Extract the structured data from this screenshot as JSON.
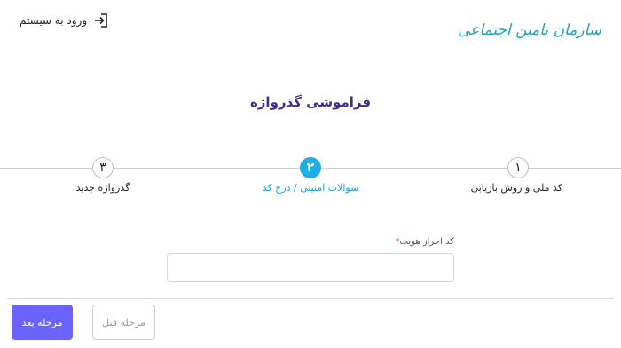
{
  "header": {
    "logo_text": "سازمان تامین اجتماعی",
    "login_label": "ورود به سیستم",
    "icons": {
      "logo": "social-security-emblem",
      "login": "sign-in-arrow-icon"
    }
  },
  "page": {
    "title": "فراموشی گذرواژه"
  },
  "stepper": {
    "steps": [
      {
        "number": "۱",
        "label": "کد ملی و روش بازیابی",
        "state": "done"
      },
      {
        "number": "۲",
        "label": "سوالات امنیتی / درج کد",
        "state": "active"
      },
      {
        "number": "۳",
        "label": "گذرواژه جدید",
        "state": "pending"
      }
    ]
  },
  "form": {
    "identity_code": {
      "label": "کد احراز هویت",
      "required_mark": "*",
      "value": "",
      "placeholder": ""
    }
  },
  "actions": {
    "next_label": "مرحله بعد",
    "prev_label": "مرحله قبل"
  },
  "colors": {
    "brand": "#18a7b8",
    "accent": "#6c63ff",
    "active_step": "#1eaee6",
    "title": "#3a2f8c",
    "required": "#e53935"
  }
}
